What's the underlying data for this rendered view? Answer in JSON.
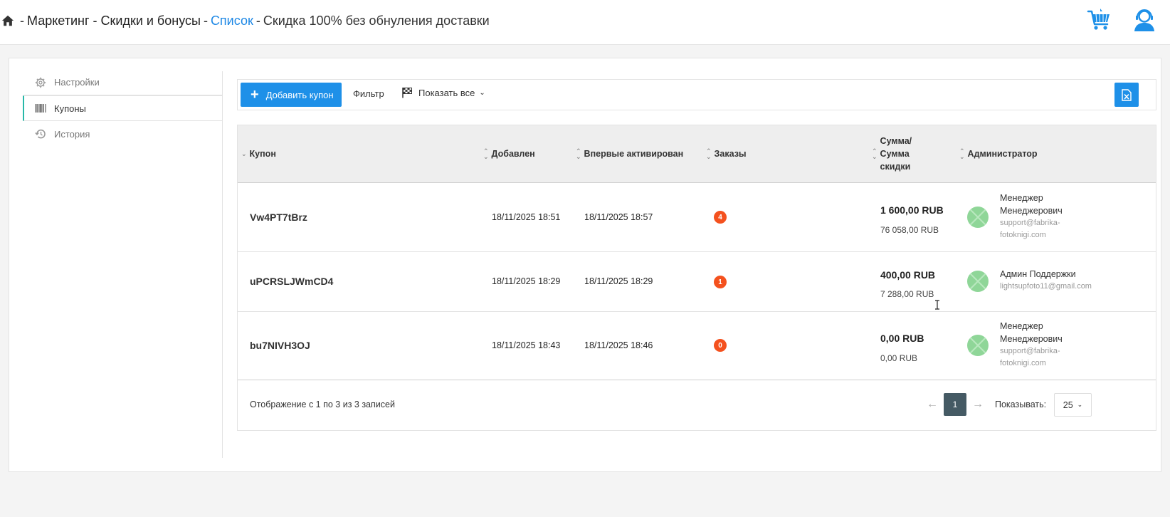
{
  "breadcrumb": {
    "sep": "-",
    "section": "Маркетинг - Скидки и бонусы",
    "link": "Список",
    "current": "Скидка 100% без обнуления доставки"
  },
  "sidebar": {
    "items": [
      {
        "label": "Настройки",
        "icon": "gear-icon"
      },
      {
        "label": "Купоны",
        "icon": "barcode-icon"
      },
      {
        "label": "История",
        "icon": "history-icon"
      }
    ]
  },
  "toolbar": {
    "add_label": "Добавить купон",
    "filter_label": "Фильтр",
    "show_all_label": "Показать все"
  },
  "table": {
    "headers": {
      "coupon": "Купон",
      "added": "Добавлен",
      "first_activated": "Впервые активирован",
      "orders": "Заказы",
      "sum_line1": "Сумма/",
      "sum_line2": "Сумма",
      "sum_line3": "скидки",
      "admin": "Администратор"
    },
    "rows": [
      {
        "code": "Vw4PT7tBrz",
        "added": "18/11/2025 18:51",
        "first_activated": "18/11/2025 18:57",
        "orders": "4",
        "sum": "1 600,00 RUB",
        "discount": "76 058,00 RUB",
        "admin_name_1": "Менеджер",
        "admin_name_2": "Менеджерович",
        "admin_mail_1": "support@fabrika-",
        "admin_mail_2": "fotoknigi.com"
      },
      {
        "code": "uPCRSLJWmCD4",
        "added": "18/11/2025 18:29",
        "first_activated": "18/11/2025 18:29",
        "orders": "1",
        "sum": "400,00 RUB",
        "discount": "7 288,00 RUB",
        "admin_name_1": "Админ Поддержки",
        "admin_mail_1": "lightsupfoto11@gmail.com"
      },
      {
        "code": "bu7NIVH3OJ",
        "added": "18/11/2025 18:43",
        "first_activated": "18/11/2025 18:46",
        "orders": "0",
        "sum": "0,00 RUB",
        "discount": "0,00 RUB",
        "admin_name_1": "Менеджер",
        "admin_name_2": "Менеджерович",
        "admin_mail_1": "support@fabrika-",
        "admin_mail_2": "fotoknigi.com"
      }
    ]
  },
  "footer": {
    "summary": "Отображение с 1 по 3 из 3 записей",
    "prev": "←",
    "current_page": "1",
    "next": "→",
    "show_label": "Показывать:",
    "per_page": "25"
  },
  "colors": {
    "accent": "#1e90e8",
    "link": "#1e88e5",
    "badge": "#f4511e",
    "active_nav": "#27b8a8"
  }
}
